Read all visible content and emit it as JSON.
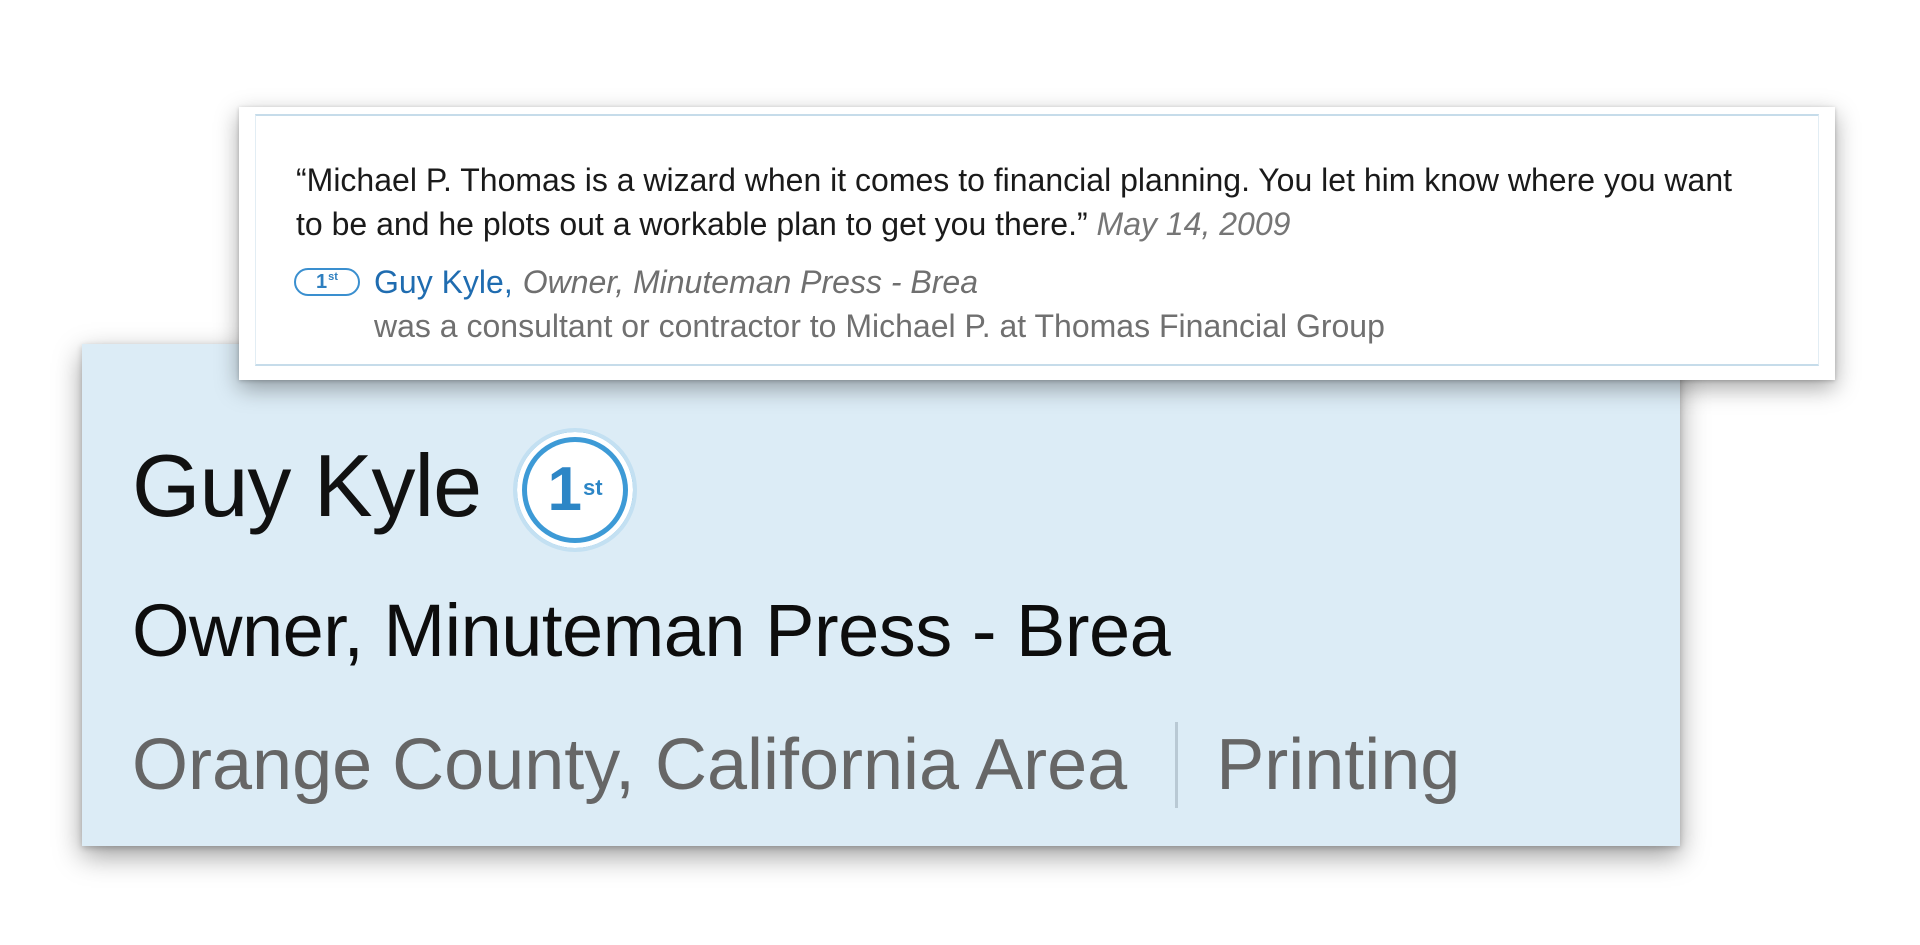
{
  "recommendation": {
    "quote": "“Michael P. Thomas is a wizard when it comes to financial planning. You let him know where you want to be and he plots out a workable plan to get you there.”",
    "date": "May 14, 2009",
    "author": {
      "degree_number": "1",
      "degree_suffix": "st",
      "name": "Guy Kyle",
      "separator": ",",
      "title": "Owner, Minuteman Press - Brea"
    },
    "relation": "was a consultant or contractor to Michael P. at Thomas Financial Group"
  },
  "profile": {
    "name": "Guy Kyle",
    "degree_number": "1",
    "degree_suffix": "st",
    "headline": "Owner, Minuteman Press - Brea",
    "location": "Orange County, California Area",
    "industry": "Printing"
  },
  "colors": {
    "card_background": "#dcecf6",
    "link_blue": "#1f6cb0",
    "badge_blue": "#3d9ad6"
  },
  "icons": {
    "degree_badge": "first-degree-connection-icon"
  }
}
